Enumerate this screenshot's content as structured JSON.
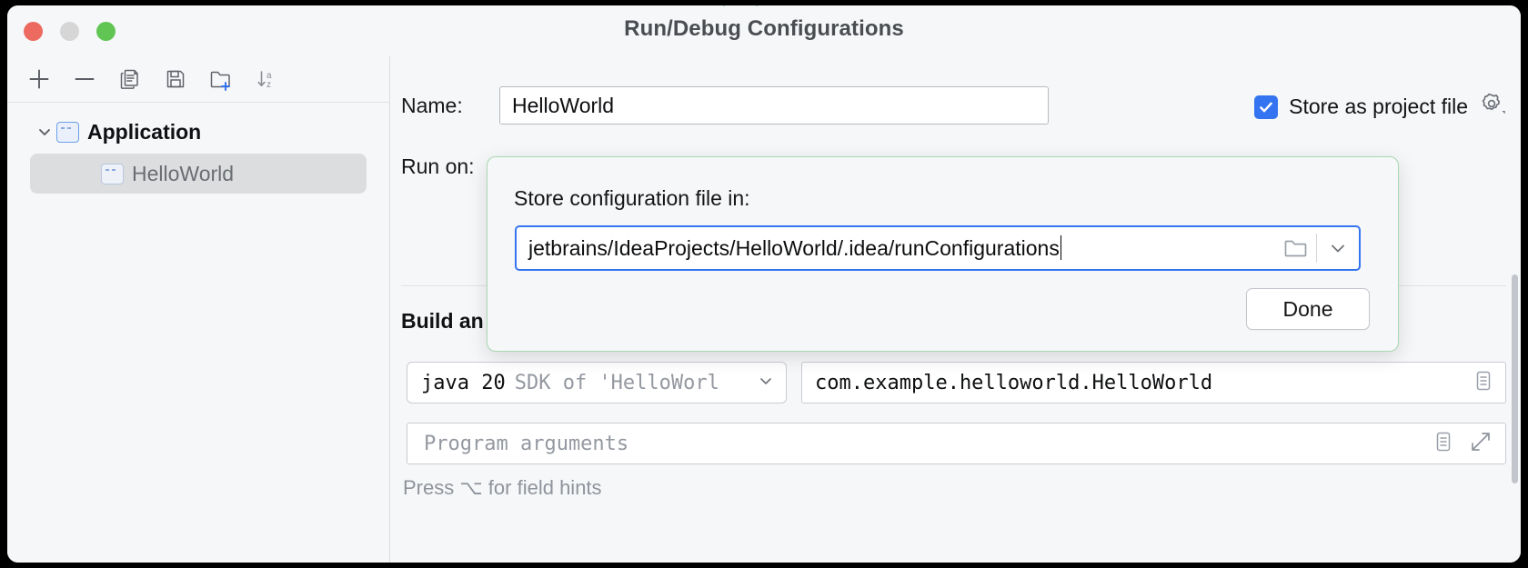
{
  "window": {
    "title": "Run/Debug Configurations",
    "traffic_lights": [
      "close",
      "minimize",
      "zoom"
    ]
  },
  "sidebar": {
    "toolbar": [
      {
        "name": "add",
        "icon": "plus-icon"
      },
      {
        "name": "remove",
        "icon": "minus-icon"
      },
      {
        "name": "copy",
        "icon": "copy-icon"
      },
      {
        "name": "save",
        "icon": "save-icon"
      },
      {
        "name": "new-folder",
        "icon": "folder-add-icon"
      },
      {
        "name": "sort",
        "icon": "sort-alpha-icon"
      }
    ],
    "tree": [
      {
        "label": "Application",
        "type": "group",
        "expanded": true
      },
      {
        "label": "HelloWorld",
        "type": "item",
        "selected": true
      }
    ]
  },
  "main": {
    "name_label": "Name:",
    "name_value": "HelloWorld",
    "store_as_project_file_label": "Store as project file",
    "store_as_project_file_checked": true,
    "run_on_label": "Run on:",
    "section_title": "Build an",
    "sdk_primary": "java 20",
    "sdk_secondary": "SDK of 'HelloWorl",
    "main_class_value": "com.example.helloworld.HelloWorld",
    "program_arguments_placeholder": "Program arguments",
    "hint": "Press ⌥ for field hints"
  },
  "popover": {
    "title": "Store configuration file in:",
    "path_value": "jetbrains/IdeaProjects/HelloWorld/.idea/runConfigurations",
    "done_label": "Done",
    "browse_icon": "folder-icon",
    "dropdown_icon": "chevron-down-icon",
    "border_color": "#a9d8b0",
    "focus_color": "#3574f0"
  },
  "colors": {
    "accent_blue": "#3574f0",
    "popover_green": "#a9d8b0",
    "window_bg": "#f6f7f9",
    "selection_gray": "#dcdddf"
  }
}
